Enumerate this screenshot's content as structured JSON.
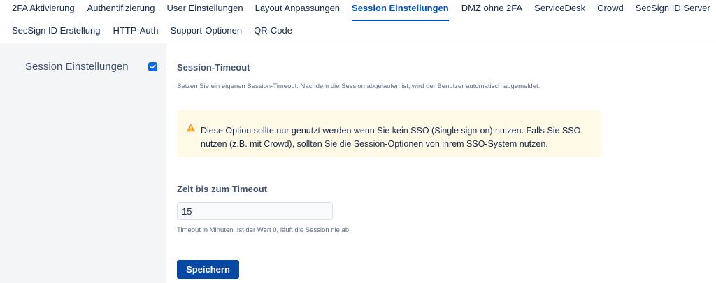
{
  "tabs_row1": [
    {
      "label": "2FA Aktivierung"
    },
    {
      "label": "Authentifizierung"
    },
    {
      "label": "User Einstellungen"
    },
    {
      "label": "Layout Anpassungen"
    },
    {
      "label": "Session Einstellungen",
      "active": true
    },
    {
      "label": "DMZ ohne 2FA"
    },
    {
      "label": "ServiceDesk"
    },
    {
      "label": "Crowd"
    },
    {
      "label": "SecSign ID Server"
    }
  ],
  "tabs_row2": [
    {
      "label": "SecSign ID Erstellung"
    },
    {
      "label": "HTTP-Auth"
    },
    {
      "label": "Support-Optionen"
    },
    {
      "label": "QR-Code"
    }
  ],
  "section": {
    "title": "Session Einstellungen",
    "enabled": true
  },
  "session_timeout": {
    "heading": "Session-Timeout",
    "description": "Setzen Sie ein eigenen Session-Timeout. Nachdem die Session abgelaufen ist, wird der Benutzer automatisch abgemeldet."
  },
  "warning": {
    "text": "Diese Option sollte nur genutzt werden wenn Sie kein SSO (Single sign-on) nutzen. Falls Sie SSO nutzen (z.B. mit Crowd), sollten Sie die Session-Optionen von ihrem SSO-System nutzen.",
    "icon": "warning-icon"
  },
  "timeout_field": {
    "label": "Zeit bis zum Timeout",
    "value": "15",
    "hint": "Timeout in Minuten. Ist der Wert 0, läuft die Session nie ab."
  },
  "actions": {
    "save_label": "Speichern"
  },
  "colors": {
    "accent": "#0052cc",
    "button": "#0747a6",
    "warning_bg": "#fffae6",
    "warning_icon": "#ff991f"
  }
}
